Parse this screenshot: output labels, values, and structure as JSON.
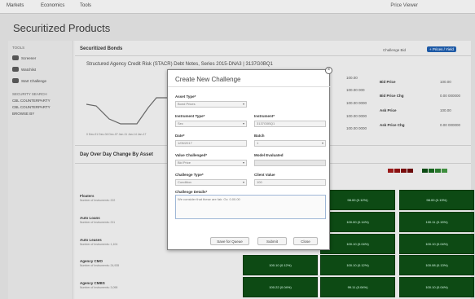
{
  "nav": {
    "items": [
      "Markets",
      "Economics",
      "Tools"
    ],
    "user": "Price Viewer"
  },
  "page_title": "Securitized Products",
  "sidebar": {
    "head1": "TOOLS",
    "items": [
      "Screener",
      "Watchlist",
      "Start Challenge"
    ],
    "head2": "SECURITY SEARCH",
    "links": [
      "CBL COUNTERPARTY",
      "CBL COUNTERPARTY",
      "BROWSE BY"
    ]
  },
  "section1": {
    "title": "Securitized Bonds",
    "bond_title": "Structured Agency Credit Risk (STACR) Debt Notes, Series 2015-DNA3 | 3137G0BQ1",
    "btn_gray": "Challenge Bid",
    "btn_blue": "+ Prices / Yield"
  },
  "chart_axis": "0   Dec-01 Dec-04 Dec-07 Jan-11 Jan-14 Jan-17",
  "prices": {
    "mid_values": [
      "100.00",
      "100.00 000",
      "100.00 0000",
      "100.00 0000",
      "100.00 0000"
    ],
    "labels": [
      "Bid Price",
      "Bid Price Chg",
      "Ask Price",
      "Ask Price Chg"
    ],
    "values": [
      "100.00",
      "0.00 000000",
      "100.00",
      "0.00 000000"
    ]
  },
  "section2": {
    "title": "Day Over Day Change By Asset"
  },
  "ladder_colors": [
    "#9a1a1a",
    "#8b1111",
    "#7a0d0d",
    "#6a0a0a",
    "#0d4a14",
    "#16631d",
    "#2a7a2e",
    "#3f8f3f"
  ],
  "rows": [
    {
      "label": "Floaters",
      "sub": "Number of Instruments: 222"
    },
    {
      "label": "Auto Loans",
      "sub": "Number of Instruments: 211"
    },
    {
      "label": "Auto Leases",
      "sub": "Number of Instruments: 1,104"
    },
    {
      "label": "Agency CMO",
      "sub": "Number of Instruments: 24,935"
    },
    {
      "label": "Agency CMBS",
      "sub": "Number of Instruments: 3,098"
    }
  ],
  "cells": [
    [
      "",
      "98.00 (0.12%)",
      "98.00 (0.13%)"
    ],
    [
      "",
      "100.00 (0.14%)",
      "100.11 (0.15%)"
    ],
    [
      "",
      "100.10 (0.04%)",
      "100.10 (0.04%)"
    ],
    [
      "100.10 (0.12%)",
      "100.10 (0.12%)",
      "100.08 (0.13%)"
    ],
    [
      "100.22 (0.04%)",
      "99.11 (0.04%)",
      "100.10 (0.04%)"
    ]
  ],
  "modal": {
    "title": "Create New Challenge",
    "fields": {
      "asset_type": {
        "label": "Asset Type*",
        "value": "Bond Prices"
      },
      "instrument_type": {
        "label": "Instrument Type*",
        "value": "Sec"
      },
      "instrument": {
        "label": "Instrument*",
        "value": "3137G0BQ1"
      },
      "date": {
        "label": "Date*",
        "value": "1/05/2017"
      },
      "batch": {
        "label": "Batch",
        "value": "1"
      },
      "value_challenged": {
        "label": "Value Challenged*",
        "value": "Bid Price"
      },
      "model_evaluated": {
        "label": "Model Evaluated",
        "value": ""
      },
      "challenge_type": {
        "label": "Challenge Type*",
        "value": "Condition"
      },
      "client_value": {
        "label": "Client Value",
        "value": "100"
      },
      "challenge_details": {
        "label": "Challenge Details*",
        "value": "We consider that these are fair. Ov. 0.00.00"
      }
    },
    "buttons": [
      "Save for Queue",
      "Submit",
      "Close"
    ]
  }
}
